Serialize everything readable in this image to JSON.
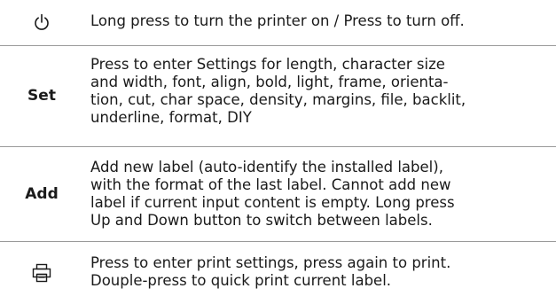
{
  "rows": [
    {
      "icon": "power-icon",
      "key": "",
      "description": "Long press to turn the printer on / Press to turn off."
    },
    {
      "icon": "",
      "key": "Set",
      "description": "Press to enter Settings for length, character size\nand width, font, align, bold, light, frame, orienta-\ntion, cut, char space, density, margins, file, backlit,\nunderline, format, DIY"
    },
    {
      "icon": "",
      "key": "Add",
      "description": "Add new label (auto-identify the installed label),\nwith the format of the last label. Cannot add new\nlabel if current input content is empty. Long press\nUp and Down button to switch between labels."
    },
    {
      "icon": "printer-icon",
      "key": "",
      "description": "Press to enter print settings, press again to print.\nDouple-press to quick print current label."
    }
  ]
}
